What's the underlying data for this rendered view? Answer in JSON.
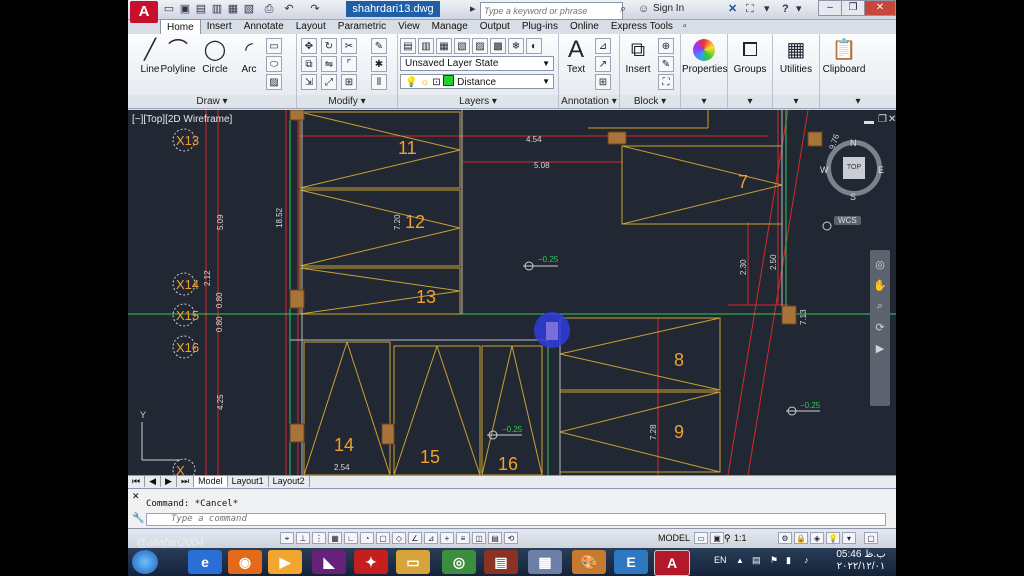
{
  "app": {
    "logo": "A",
    "document_title": "shahrdari13.dwg",
    "search_placeholder": "Type a keyword or phrase",
    "sign_in": "Sign In"
  },
  "ribbon_tabs": [
    "Home",
    "Insert",
    "Annotate",
    "Layout",
    "Parametric",
    "View",
    "Manage",
    "Output",
    "Plug-ins",
    "Online",
    "Express Tools"
  ],
  "ribbon": {
    "draw": {
      "title": "Draw",
      "tools": [
        "Line",
        "Polyline",
        "Circle",
        "Arc"
      ]
    },
    "modify": {
      "title": "Modify"
    },
    "layers": {
      "title": "Layers",
      "layer_state": "Unsaved Layer State",
      "current_layer": "Distance"
    },
    "annotation": {
      "title": "Annotation",
      "text_label": "Text"
    },
    "block": {
      "title": "Block",
      "insert_label": "Insert"
    },
    "big_tools": [
      "Properties",
      "Groups",
      "Utilities",
      "Clipboard"
    ]
  },
  "viewport": {
    "label": "[−][Top][2D Wireframe]",
    "viewcube": {
      "top": "TOP",
      "n": "N",
      "s": "S",
      "e": "E",
      "w": "W",
      "wcs": "WCS"
    },
    "rooms": [
      "11",
      "12",
      "13",
      "7",
      "8",
      "9",
      "14",
      "15",
      "16"
    ],
    "grid_markers": [
      "X13",
      "X14",
      "X15",
      "X16",
      "X"
    ],
    "dimensions": [
      "4.54",
      "5.08",
      "18.52",
      "5.09",
      "2.12",
      "0.80",
      "0.80",
      "4.25",
      "2.54",
      "7.20",
      "2.30",
      "2.50",
      "7.13",
      "7.28",
      "9.76",
      "−0.25",
      "−0.25",
      "−0.25"
    ],
    "axis_y": "Y"
  },
  "layout_tabs": [
    "Model",
    "Layout1",
    "Layout2"
  ],
  "command": {
    "history": "Command: *Cancel*",
    "placeholder": "Type a command"
  },
  "status": {
    "space": "MODEL",
    "scale": "1:1"
  },
  "taskbar": {
    "language": "EN",
    "time": "05:46 ب.ظ",
    "date": "۲۰۲۲/۱۲/۰۱",
    "watermark": "@aliafari2004"
  },
  "colors": {
    "drawing_bg": "#222833",
    "room_lines": "#c9a033",
    "room_numbers": "#f0a030",
    "grid_red": "#d62828",
    "green_line": "#34c759",
    "cursor_blue": "#2f3be0"
  }
}
